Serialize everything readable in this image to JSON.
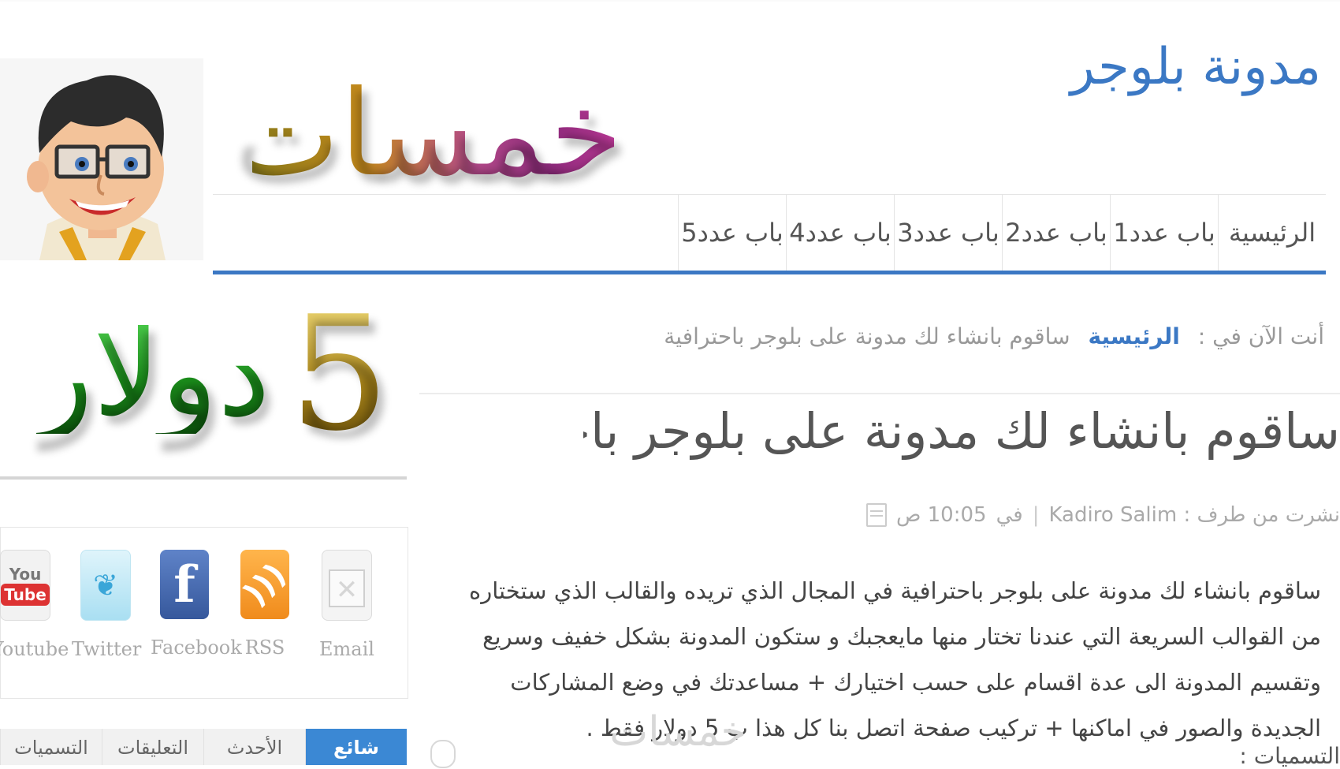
{
  "blog_title": "مدونة بلوجر",
  "brand_logo": "خمسات",
  "price_logo": {
    "number": "5",
    "word": "دولار"
  },
  "nav": [
    "الرئيسية",
    "باب عدد1",
    "باب عدد2",
    "باب عدد3",
    "باب عدد4",
    "باب عدد5"
  ],
  "breadcrumb": {
    "prefix": "أنت الآن في :",
    "home": "الرئيسية",
    "current": "ساقوم بانشاء لك مدونة على بلوجر باحترافية"
  },
  "post": {
    "title": "ساقوم بانشاء لك مدونة على بلوجر باحترافية",
    "meta": {
      "author_label": "نشرت من طرف : Kadiro Salim",
      "in_label": "في",
      "time": "10:05 ص"
    },
    "body": "ساقوم بانشاء لك مدونة على بلوجر باحترافية في المجال الذي تريده والقالب الذي ستختاره من القوالب السريعة التي عندنا تختار منها مايعجبك و ستكون المدونة بشكل خفيف وسريع وتقسيم المدونة الى عدة اقسام على حسب اختيارك + مساعدتك في وضع المشاركات الجديدة والصور في اماكنها + تركيب صفحة اتصل بنا كل هذا ب 5 دولار فقط .",
    "tags_label": "التسميات :"
  },
  "watermark": "خمسات",
  "social": [
    {
      "label": "Email",
      "icon": "email-icon"
    },
    {
      "label": "RSS",
      "icon": "rss-icon"
    },
    {
      "label": "Facebook",
      "icon": "facebook-icon"
    },
    {
      "label": "Twitter",
      "icon": "twitter-icon"
    },
    {
      "label": "Youtube",
      "icon": "youtube-icon"
    }
  ],
  "youtube_glyph": {
    "top": "You",
    "bottom": "Tube"
  },
  "tabs": [
    "شائع",
    "الأحدث",
    "التعليقات",
    "التسميات"
  ],
  "colors": {
    "accent": "#3b78c4",
    "tab_active": "#3b88d4"
  }
}
